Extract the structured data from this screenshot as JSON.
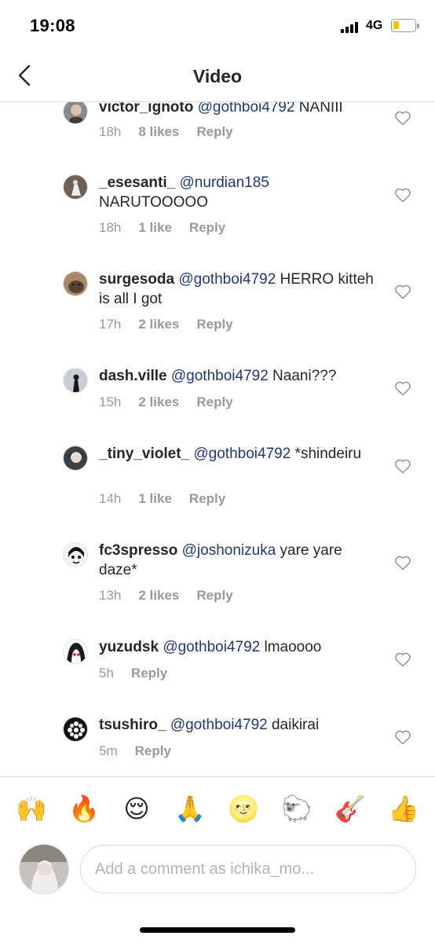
{
  "status_bar": {
    "time": "19:08",
    "network": "4G"
  },
  "nav": {
    "title": "Video"
  },
  "comments": [
    {
      "username": "victor_ignoto",
      "mention": "@gothboi4792",
      "text": " NANIII",
      "time": "18h",
      "likes": "8 likes",
      "reply": "Reply"
    },
    {
      "username": "_esesanti_",
      "mention": "@nurdian185",
      "text": " NARUTOOOOO",
      "time": "18h",
      "likes": "1 like",
      "reply": "Reply"
    },
    {
      "username": "surgesoda",
      "mention": "@gothboi4792",
      "text": " HERRO kitteh is all I got",
      "time": "17h",
      "likes": "2 likes",
      "reply": "Reply"
    },
    {
      "username": "dash.ville",
      "mention": "@gothboi4792",
      "text": " Naani???",
      "time": "15h",
      "likes": "2 likes",
      "reply": "Reply"
    },
    {
      "username": "_tiny_violet_",
      "mention": "@gothboi4792",
      "text": " *shindeiru",
      "time": "14h",
      "likes": "1 like",
      "reply": "Reply"
    },
    {
      "username": "fc3spresso",
      "mention": "@joshonizuka",
      "text": " yare yare daze*",
      "time": "13h",
      "likes": "2 likes",
      "reply": "Reply"
    },
    {
      "username": "yuzudsk",
      "mention": "@gothboi4792",
      "text": " lmaoooo",
      "time": "5h",
      "likes": "",
      "reply": "Reply"
    },
    {
      "username": "tsushiro_",
      "mention": "@gothboi4792",
      "text": " daikirai",
      "time": "5m",
      "likes": "",
      "reply": "Reply"
    }
  ],
  "emoji_bar": [
    "🙌",
    "🔥",
    "😌",
    "🙏",
    "🌝",
    "🐑",
    "🎸",
    "👍"
  ],
  "composer": {
    "placeholder": "Add a comment as ichika_mo..."
  },
  "colors": {
    "mention": "#1e3a6e",
    "meta": "#999999",
    "divider": "#dbdbdb",
    "battery": "#f5c400"
  }
}
